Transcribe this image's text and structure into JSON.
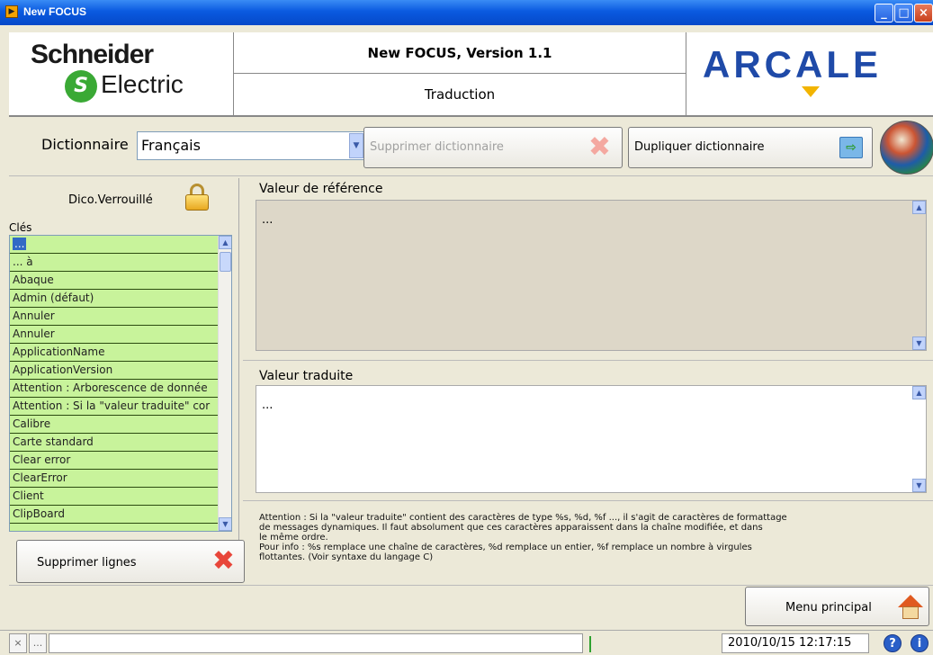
{
  "window": {
    "title": "New FOCUS"
  },
  "header": {
    "brand_left_line1": "Schneider",
    "brand_left_line2": "Electric",
    "app_title": "New FOCUS, Version 1.1",
    "page_title": "Traduction",
    "brand_right": "ARCALE"
  },
  "toolbar": {
    "dictionary_label": "Dictionnaire",
    "dictionary_value": "Français",
    "delete_dictionary_label": "Supprimer dictionnaire",
    "duplicate_dictionary_label": "Dupliquer dictionnaire"
  },
  "left_panel": {
    "lock_label": "Dico.Verrouillé",
    "keys_label": "Clés",
    "keys": [
      "...",
      "... à",
      "Abaque",
      "Admin (défaut)",
      "Annuler",
      "Annuler",
      "ApplicationName",
      "ApplicationVersion",
      "Attention : Arborescence de donnée",
      "Attention : Si la \"valeur traduite\" cor",
      "Calibre",
      "Carte standard",
      "Clear error",
      "ClearError",
      "Client",
      "ClipBoard"
    ],
    "delete_lines_label": "Supprimer lignes"
  },
  "right_panel": {
    "reference_label": "Valeur de référence",
    "reference_value": "...",
    "translated_label": "Valeur traduite",
    "translated_value": "...",
    "info_lines": [
      "Attention : Si la \"valeur traduite\" contient des caractères de type %s, %d, %f ..., il s'agit de caractères de formattage",
      "de messages dynamiques. Il faut absolument que ces caractères apparaissent dans la chaîne modifiée, et dans",
      "le même ordre.",
      "Pour info : %s remplace une chaîne de caractères, %d remplace un entier, %f remplace un nombre à virgules",
      "flottantes. (Voir syntaxe du langage C)"
    ]
  },
  "footer": {
    "main_menu_label": "Menu principal"
  },
  "statusbar": {
    "close_glyph": "×",
    "more_glyph": "...",
    "datetime": "2010/10/15 12:17:15"
  },
  "colors": {
    "key_row_bg": "#c8f39b",
    "reference_bg": "#ddd7c8",
    "accent_blue": "#1f4aa8",
    "delete_red": "#e8463a"
  }
}
